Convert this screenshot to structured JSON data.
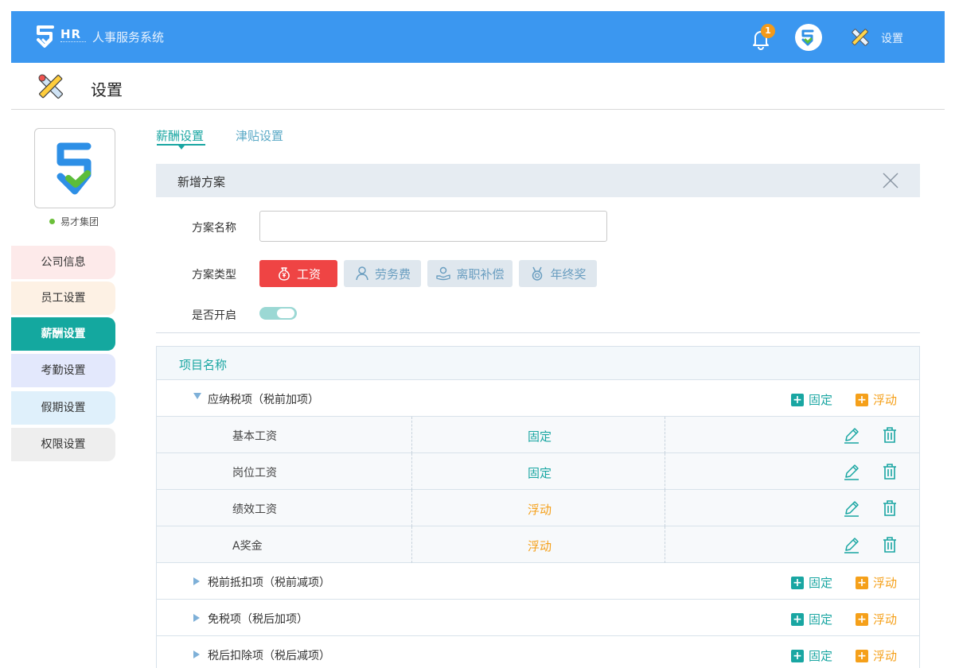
{
  "header": {
    "brand": "HR",
    "app_title": "人事服务系统",
    "notification_count": "1",
    "settings_label": "设置",
    "colors": {
      "bar": "#3b97f0",
      "badge": "#f39a1b"
    }
  },
  "page": {
    "title": "设置"
  },
  "sidebar": {
    "company_name": "易才集团",
    "items": [
      {
        "label": "公司信息",
        "color": "#fdeaea"
      },
      {
        "label": "员工设置",
        "color": "#fdf1e4"
      },
      {
        "label": "薪酬设置",
        "color": "#14a89f",
        "active": true
      },
      {
        "label": "考勤设置",
        "color": "#e3e8fc"
      },
      {
        "label": "假期设置",
        "color": "#dff0fb"
      },
      {
        "label": "权限设置",
        "color": "#eeeeee"
      }
    ]
  },
  "tabs": [
    {
      "label": "薪酬设置",
      "active": true
    },
    {
      "label": "津贴设置",
      "active": false
    }
  ],
  "form": {
    "title": "新增方案",
    "name_label": "方案名称",
    "name_value": "",
    "type_label": "方案类型",
    "types": [
      {
        "label": "工资",
        "icon": "money-bag-icon",
        "active": true
      },
      {
        "label": "劳务费",
        "icon": "person-icon",
        "active": false
      },
      {
        "label": "离职补偿",
        "icon": "hand-person-icon",
        "active": false
      },
      {
        "label": "年终奖",
        "icon": "medal-icon",
        "active": false
      }
    ],
    "enable_label": "是否开启",
    "enabled": true
  },
  "items_table": {
    "header": "项目名称",
    "add_fixed_label": "固定",
    "add_float_label": "浮动",
    "groups": [
      {
        "title": "应纳税项（税前加项）",
        "expanded": true,
        "items": [
          {
            "name": "基本工资",
            "type": "固定",
            "kind": "fixed"
          },
          {
            "name": "岗位工资",
            "type": "固定",
            "kind": "fixed"
          },
          {
            "name": "绩效工资",
            "type": "浮动",
            "kind": "float"
          },
          {
            "name": "A奖金",
            "type": "浮动",
            "kind": "float"
          }
        ]
      },
      {
        "title": "税前抵扣项（税前减项）",
        "expanded": false
      },
      {
        "title": "免税项（税后加项）",
        "expanded": false
      },
      {
        "title": "税后扣除项（税后减项）",
        "expanded": false
      }
    ]
  }
}
